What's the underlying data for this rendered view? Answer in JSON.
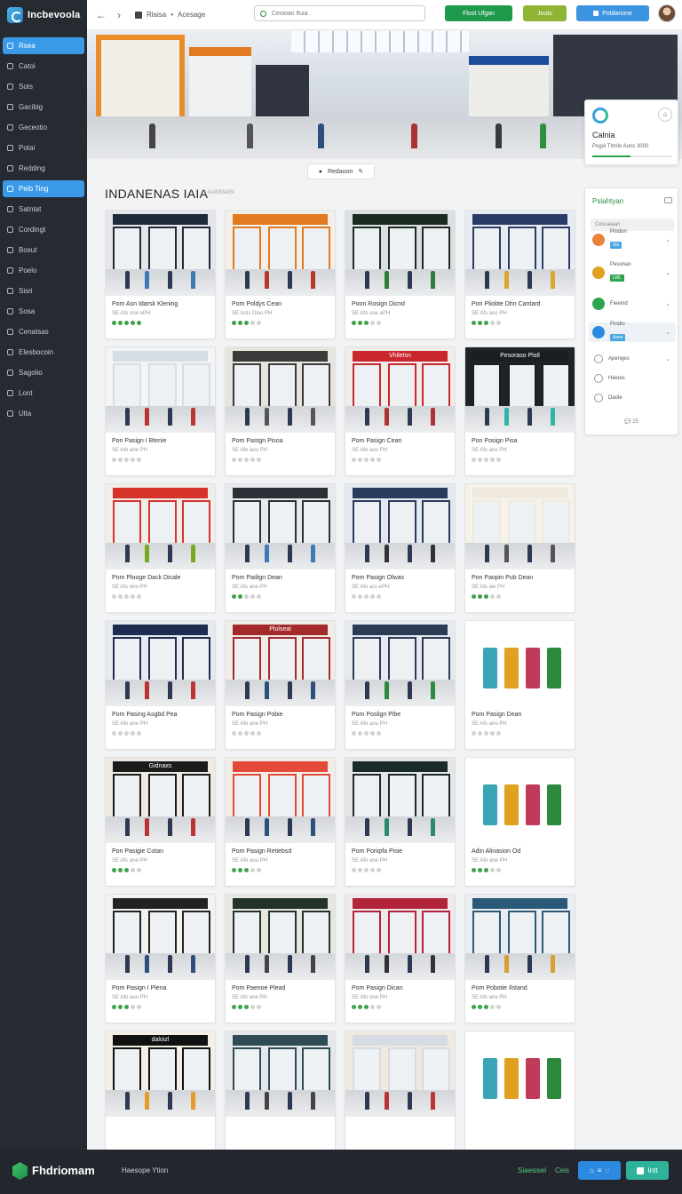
{
  "brand": {
    "name": "Incbevoola"
  },
  "sidebar": {
    "items": [
      {
        "label": "Rsea",
        "active": true
      },
      {
        "label": "Catoi",
        "active": false
      },
      {
        "label": "Sots",
        "active": false
      },
      {
        "label": "Gacibig",
        "active": false
      },
      {
        "label": "Geceotio",
        "active": false
      },
      {
        "label": "Potai",
        "active": false
      },
      {
        "label": "Redding",
        "active": false
      },
      {
        "label": "Peib Ting",
        "active": true
      },
      {
        "label": "Satntat",
        "active": false
      },
      {
        "label": "Cordingt",
        "active": false
      },
      {
        "label": "Bosut",
        "active": false
      },
      {
        "label": "Poelo",
        "active": false
      },
      {
        "label": "Sisri",
        "active": false
      },
      {
        "label": "Sosa",
        "active": false
      },
      {
        "label": "Cenatsas",
        "active": false
      },
      {
        "label": "Elesbocoin",
        "active": false
      },
      {
        "label": "Sagolio",
        "active": false
      },
      {
        "label": "Lont",
        "active": false
      },
      {
        "label": "Ulta",
        "active": false
      }
    ]
  },
  "topbar": {
    "back": "←",
    "forward": "›",
    "crumb_home": "Rlaisa",
    "crumb_sep": "•",
    "crumb_current": "Acesage",
    "search_placeholder": "Cesioan lfuia",
    "btn_primary": "Flost Ufgan",
    "btn_secondary": "Jouto",
    "btn_tertiary": "Potdanone"
  },
  "hero": {
    "toolbar_label": "Redaoon"
  },
  "float_card": {
    "title": "Calnia",
    "sub_left": "Pogol",
    "sub_mid": "Tlm/lo",
    "sub_right": "Aons",
    "sub_tail": "3000",
    "progress": 0.48
  },
  "section": {
    "title": "INDANENAS IAIA",
    "sub": "• AUASSASI"
  },
  "cards": [
    {
      "title": "Pom Asn Idarsk Klening",
      "sub": "SE Afo one ePH",
      "rating": 5
    },
    {
      "title": "Pom Poldys Cean",
      "sub": "SE Ants Dioo PH",
      "rating": 3
    },
    {
      "title": "Poon Rosign Dicnd",
      "sub": "SE Afo one ePH",
      "rating": 3
    },
    {
      "title": "Pon Pliobte Dhn Cantard",
      "sub": "SE Afs ano PH",
      "rating": 3
    },
    {
      "title": "Pon Pasign I Btenie",
      "sub": "SE Afo ane PH",
      "rating": 0
    },
    {
      "title": "Pom Pastgn Pisoa",
      "sub": "SE Afo aou PH",
      "rating": 0
    },
    {
      "title": "Pom Pasign Cean",
      "sub": "SE Afo aou PH",
      "rating": 0
    },
    {
      "title": "Pon Posign Pisa",
      "sub": "SE Afs ano PH",
      "rating": 0
    },
    {
      "title": "Pom Plooge Dack Dicale",
      "sub": "SE Afs ono PH",
      "rating": 0
    },
    {
      "title": "Pom Padign Dean",
      "sub": "SE Afs ane PH",
      "rating": 2
    },
    {
      "title": "Pom Pasign Olwas",
      "sub": "SE Afo aru ePH",
      "rating": 0
    },
    {
      "title": "Pon Paopin Pub Dean",
      "sub": "SE Afs aw PH",
      "rating": 3
    },
    {
      "title": "Pom Pasing Asgbd Pea",
      "sub": "SE Afo ane PH",
      "rating": 0
    },
    {
      "title": "Pom Pasign Pobie",
      "sub": "SE Afo ane PH",
      "rating": 0
    },
    {
      "title": "Pom Poslign Pibe",
      "sub": "SE Afo aou PH",
      "rating": 0
    },
    {
      "title": "Pom Pasign Dean",
      "sub": "SE Afs ano PH",
      "rating": 0
    },
    {
      "title": "Pon Pasigie Cotan",
      "sub": "SE Afs ane PH",
      "rating": 3
    },
    {
      "title": "Pom Pasign Retiebsd",
      "sub": "SE Afo aou PH",
      "rating": 3
    },
    {
      "title": "Pom Ponipfa Pisie",
      "sub": "SE Afo ane PH",
      "rating": 0
    },
    {
      "title": "Adin Alinasion Od",
      "sub": "SE Afo ane PH",
      "rating": 3
    },
    {
      "title": "Pom Pasign I Plena",
      "sub": "SE Afo aou PH",
      "rating": 3
    },
    {
      "title": "Pom Paenoe Plead",
      "sub": "SE Afs ane PH",
      "rating": 3
    },
    {
      "title": "Pom Pasign Dican",
      "sub": "SE Afo one PH",
      "rating": 3
    },
    {
      "title": "Pom Pobotie Ilstand",
      "sub": "SE Afs ane PH",
      "rating": 3
    },
    {
      "title": "",
      "sub": "",
      "rating": 0
    },
    {
      "title": "",
      "sub": "",
      "rating": 0
    },
    {
      "title": "",
      "sub": "",
      "rating": 0
    },
    {
      "title": "",
      "sub": "",
      "rating": 0
    }
  ],
  "thumb_signs": [
    "",
    "",
    "",
    "",
    "",
    "",
    "Vhiletsn",
    "Pesoraso Pistl",
    "",
    "",
    "",
    "",
    "",
    "Plolseal",
    "",
    "",
    "Gidnaxs",
    "",
    "",
    "",
    "",
    "",
    "",
    "",
    "daloizl",
    "",
    "",
    ""
  ],
  "panel": {
    "title": "Pslahtyan",
    "search": "Cescaiaan",
    "rows": [
      {
        "label": "Pindon",
        "tag": "Slu",
        "color": "#e8843a",
        "tag_color": "#4aa8e0"
      },
      {
        "label": "Pesonan",
        "tag": "LWL",
        "color": "#e0a020",
        "tag_color": "#2fa44f"
      },
      {
        "label": "Fieeind",
        "tag": "",
        "color": "#2fa44f",
        "tag_color": ""
      },
      {
        "label": "Pindio",
        "tag": "Asen",
        "color": "#2a8ae0",
        "tag_color": "#4aa8e0"
      },
      {
        "label": "Apenges",
        "tag": "",
        "color": "",
        "tag_color": ""
      },
      {
        "label": "Hieoes",
        "tag": "",
        "color": "",
        "tag_color": ""
      },
      {
        "label": "Daole",
        "tag": "",
        "color": "",
        "tag_color": ""
      }
    ],
    "count": "25"
  },
  "bottombar": {
    "brand": "Fhdriomam",
    "view_label": "Haesope Ytion",
    "link1": "Siaesisel",
    "link2": "Ceis",
    "btn_label": "Intt"
  },
  "colors": {
    "sidebar_bg": "#262a31",
    "accent_blue": "#3a9ae8",
    "accent_green": "#2aa24a",
    "btn_green": "#1f9a4c",
    "btn_olive": "#8fb534",
    "btn_blue": "#3d94e0"
  }
}
